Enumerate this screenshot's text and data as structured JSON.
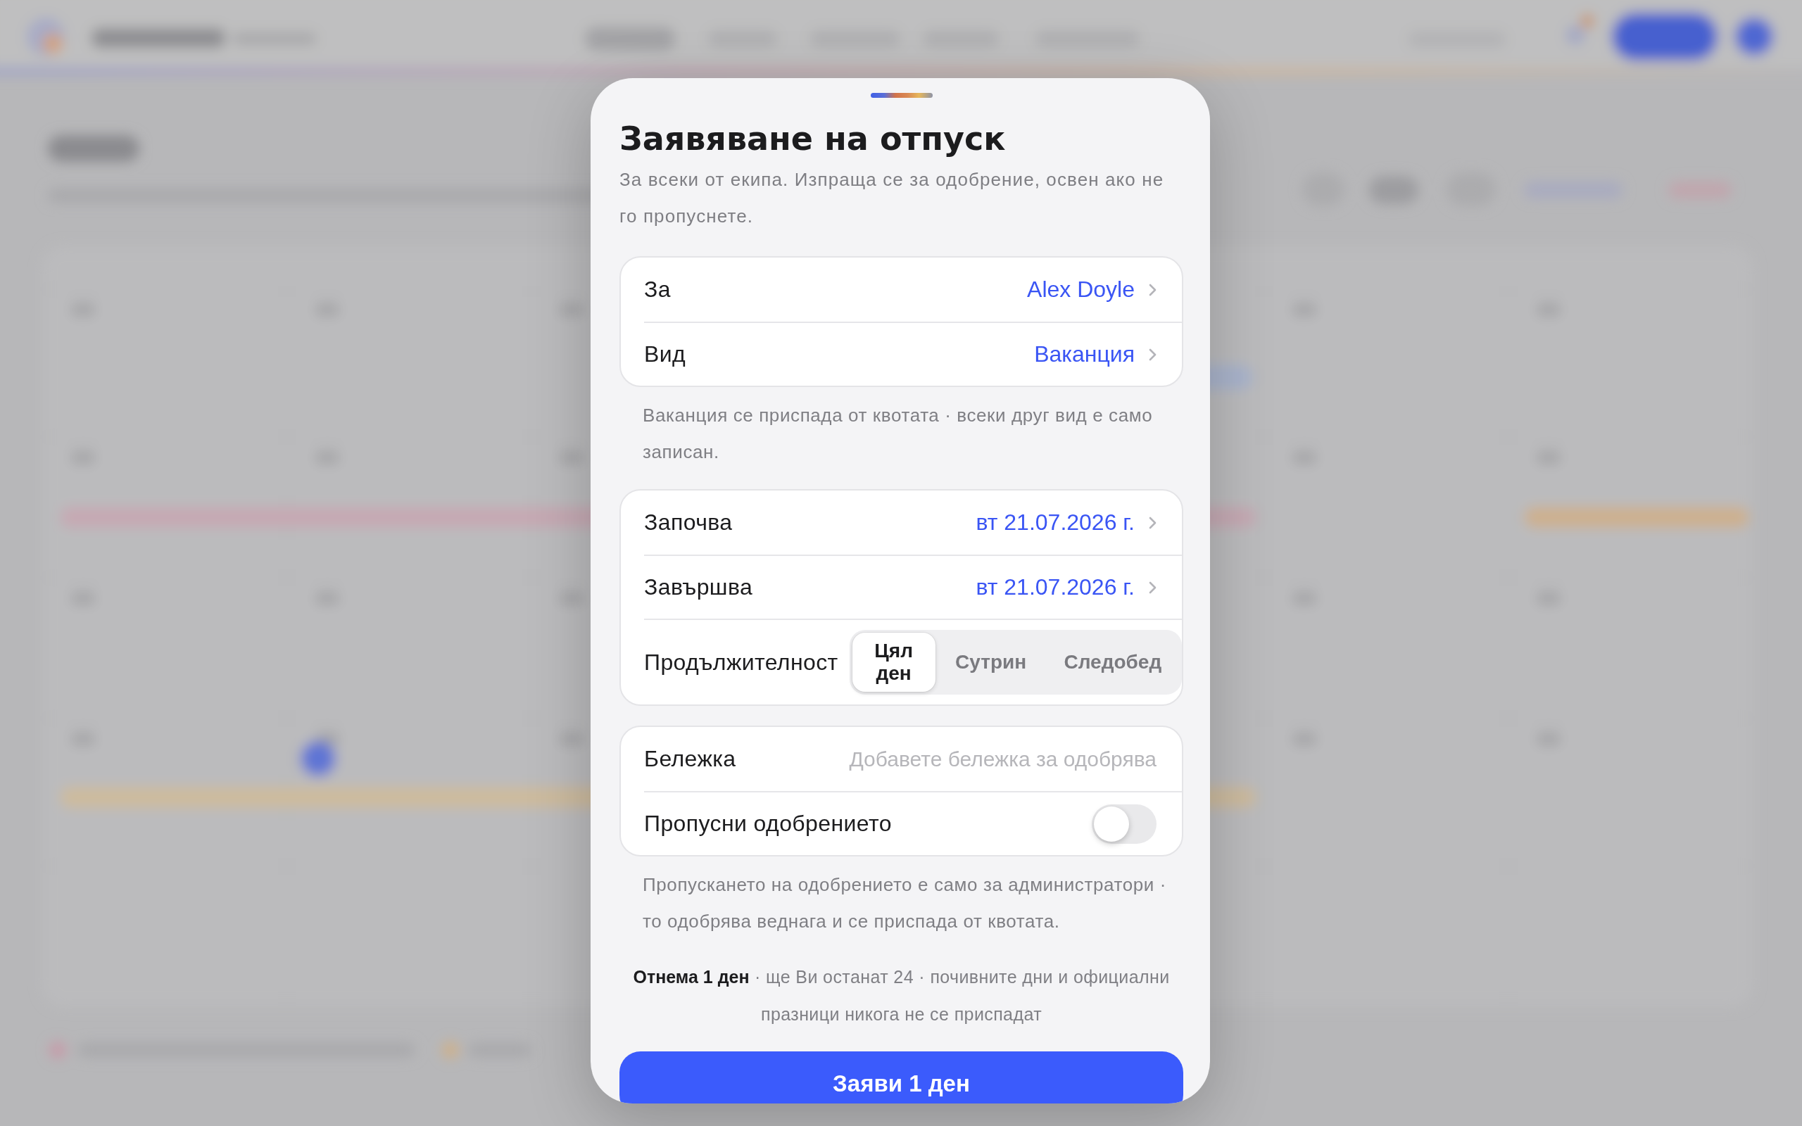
{
  "sheet": {
    "title": "Заявяване на отпуск",
    "subtitle": "За всеки от екипа. Изпраща се за одобрение, освен ако не го пропуснете."
  },
  "groups": [
    {
      "rows": [
        {
          "kind": "picker",
          "label": "За",
          "value": "Alex Doyle"
        },
        {
          "kind": "picker",
          "label": "Вид",
          "value": "Ваканция"
        }
      ],
      "note": "Ваканция се приспада от квотата · всеки друг вид е само записан."
    },
    {
      "rows": [
        {
          "kind": "picker",
          "label": "Започва",
          "value": "вт 21.07.2026 г."
        },
        {
          "kind": "picker",
          "label": "Завършва",
          "value": "вт 21.07.2026 г."
        },
        {
          "kind": "segmented",
          "label": "Продължителност",
          "options": [
            {
              "label": "Цял ден",
              "selected": true
            },
            {
              "label": "Сутрин",
              "selected": false
            },
            {
              "label": "Следобед",
              "selected": false
            }
          ]
        }
      ]
    },
    {
      "rows": [
        {
          "kind": "text",
          "label": "Бележка",
          "placeholder": "Добавете бележка за одобрява"
        },
        {
          "kind": "toggle",
          "label": "Пропусни одобрението",
          "on": false
        }
      ],
      "note": "Пропускането на одобрението е само за администратори · то одобрява веднага и се приспада от квотата."
    }
  ],
  "summary": "**Отнема 1 ден** · ще Ви останат 24 · почивните дни и официални празници никога не се приспадат",
  "submit": "Заяви 1 ден"
}
